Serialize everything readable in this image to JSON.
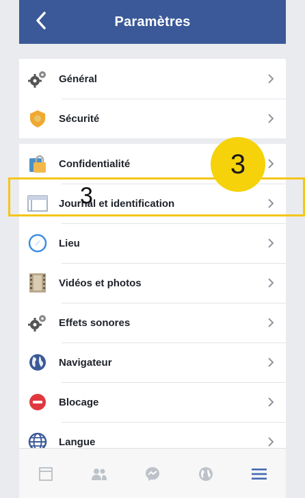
{
  "header": {
    "title": "Paramètres",
    "back_icon": "back-chevron-icon"
  },
  "settings": {
    "group1": [
      {
        "label": "Général",
        "icon": "gears-icon"
      },
      {
        "label": "Sécurité",
        "icon": "shield-icon"
      }
    ],
    "group2": [
      {
        "label": "Confidentialité",
        "icon": "lock-icon"
      },
      {
        "label": "Journal et identification",
        "icon": "timeline-icon"
      },
      {
        "label": "Lieu",
        "icon": "location-compass-icon"
      },
      {
        "label": "Vidéos et photos",
        "icon": "film-icon"
      },
      {
        "label": "Effets sonores",
        "icon": "gears-icon"
      },
      {
        "label": "Navigateur",
        "icon": "globe-icon"
      },
      {
        "label": "Blocage",
        "icon": "block-icon"
      },
      {
        "label": "Langue",
        "icon": "language-globe-icon"
      }
    ]
  },
  "tabbar": {
    "tabs": [
      "feed-icon",
      "friends-icon",
      "messenger-icon",
      "notifications-globe-icon",
      "menu-icon"
    ],
    "active_tab": "menu-icon"
  },
  "annotation": {
    "badge_number": "3",
    "step_number": "3"
  },
  "colors": {
    "header": "#3b5998",
    "highlight": "#f5c518",
    "active_tab": "#4267b2"
  }
}
